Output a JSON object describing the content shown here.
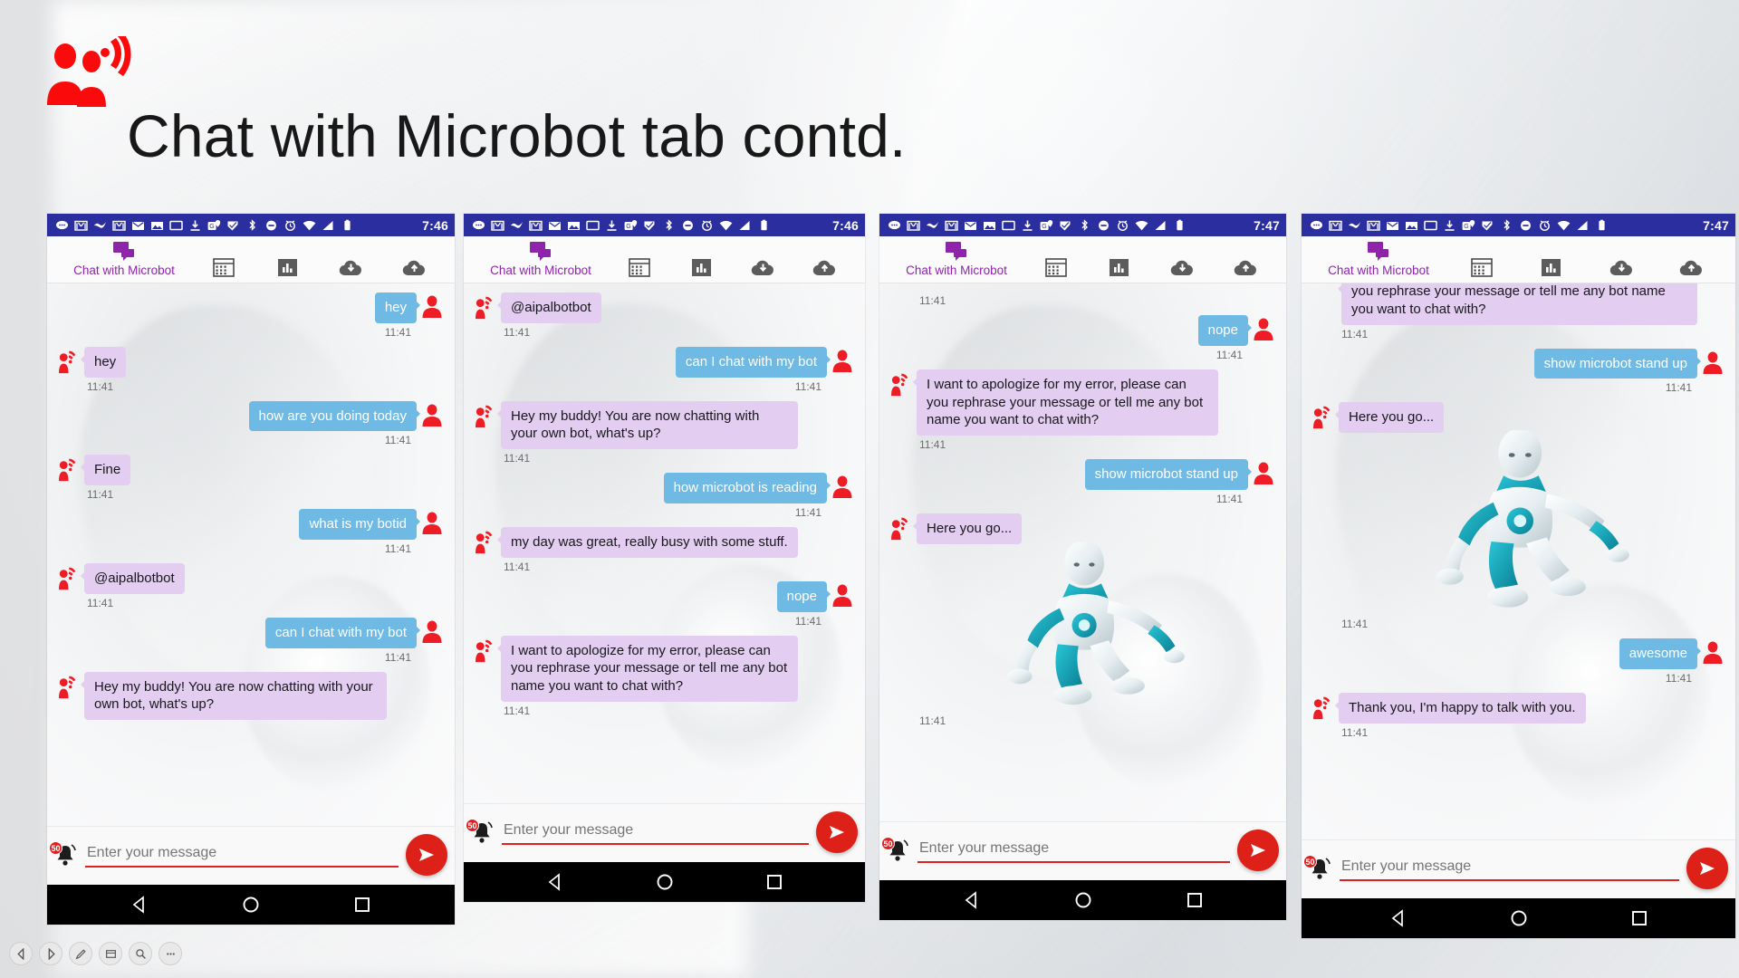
{
  "slide": {
    "title": "Chat with Microbot tab contd.",
    "logo_icon": "people-broadcast-icon"
  },
  "tabbar": {
    "chat_tab_label": "Chat with Microbot",
    "chat_tab_icon": "chat-bubbles-icon",
    "grid_tab_icon": "table-grid-icon",
    "chart_tab_icon": "bar-chart-icon",
    "download_tab_icon": "cloud-download-icon",
    "upload_tab_icon": "cloud-upload-icon",
    "accent_color": "#8e24aa"
  },
  "statusbar": {
    "icons": [
      "sms-icon",
      "gmail-icon",
      "check-icon",
      "gmail-icon",
      "mail-icon",
      "photo-icon",
      "cast-icon",
      "download-icon",
      "maps-icon",
      "tick-icon",
      "bluetooth-icon",
      "dnd-icon",
      "alarm-icon",
      "wifi-icon",
      "signal-icon",
      "battery-icon"
    ],
    "bar_color": "#2b2e9e"
  },
  "composer": {
    "placeholder": "Enter your message",
    "value": "",
    "bell_icon": "notification-bell-icon",
    "bell_badge": "50",
    "send_icon": "send-arrow-icon",
    "send_color": "#dd2119",
    "underline_color": "#e02020"
  },
  "navbar": {
    "back_icon": "nav-back-triangle-icon",
    "home_icon": "nav-home-circle-icon",
    "recents_icon": "nav-recents-square-icon"
  },
  "bottom_toolbar": {
    "buttons": [
      {
        "icon": "prev-arrow-icon"
      },
      {
        "icon": "next-arrow-icon"
      },
      {
        "icon": "pen-icon"
      },
      {
        "icon": "slides-icon"
      },
      {
        "icon": "zoom-icon"
      },
      {
        "icon": "more-options-icon"
      }
    ]
  },
  "colors": {
    "bot_bubble": "#e3cdf0",
    "user_bubble": "#6ebae4",
    "avatar_red": "#ee1c24",
    "timestamp": "#6c6c6c"
  },
  "phones": [
    {
      "id": "phone-1",
      "time": "7:46",
      "pin_bottom": false,
      "messages": [
        {
          "from": "user",
          "text": "hey",
          "time": "11:41"
        },
        {
          "from": "bot",
          "text": "hey",
          "time": "11:41"
        },
        {
          "from": "user",
          "text": "how are you doing today",
          "time": "11:41"
        },
        {
          "from": "bot",
          "text": "Fine",
          "time": "11:41"
        },
        {
          "from": "user",
          "text": "what is my botid",
          "time": "11:41"
        },
        {
          "from": "bot",
          "text": "@aipalbotbot",
          "time": "11:41"
        },
        {
          "from": "user",
          "text": "can I chat with my bot",
          "time": "11:41"
        },
        {
          "from": "bot",
          "text": "Hey my buddy! You are now chatting with your own bot, what's up?",
          "time": ""
        }
      ]
    },
    {
      "id": "phone-2",
      "time": "7:46",
      "pin_bottom": false,
      "messages": [
        {
          "from": "bot",
          "text": "@aipalbotbot",
          "time": "11:41"
        },
        {
          "from": "user",
          "text": "can I chat with my bot",
          "time": "11:41"
        },
        {
          "from": "bot",
          "text": "Hey my buddy! You are now chatting with your own bot, what's up?",
          "time": "11:41"
        },
        {
          "from": "user",
          "text": "how microbot is reading",
          "time": "11:41"
        },
        {
          "from": "bot",
          "text": "my day was great, really busy with some stuff.",
          "time": "11:41"
        },
        {
          "from": "user",
          "text": "nope",
          "time": "11:41"
        },
        {
          "from": "bot",
          "text": "I want to apologize for my error, please can you rephrase your message or tell me any bot name you want to chat with?",
          "time": "11:41"
        }
      ]
    },
    {
      "id": "phone-3",
      "time": "7:47",
      "pin_bottom": false,
      "lead_stamp": "11:41",
      "messages": [
        {
          "from": "user",
          "text": "nope",
          "time": "11:41"
        },
        {
          "from": "bot",
          "text": "I want to apologize for my error, please can you rephrase your message or tell me any bot name you want to chat with?",
          "time": "11:41"
        },
        {
          "from": "user",
          "text": "show microbot stand up",
          "time": "11:41"
        },
        {
          "from": "bot",
          "text": "Here you go...",
          "time": "11:41",
          "attachment": "robot-standing-image"
        }
      ]
    },
    {
      "id": "phone-4",
      "time": "7:47",
      "pin_bottom": false,
      "clipped_top": "you rephrase your message or tell me any bot name you want to chat with?",
      "lead_stamp": "11:41",
      "messages": [
        {
          "from": "user",
          "text": "show microbot stand up",
          "time": "11:41"
        },
        {
          "from": "bot",
          "text": "Here you go...",
          "time": "11:41",
          "attachment": "robot-standing-image"
        },
        {
          "from": "user",
          "text": "awesome",
          "time": "11:41"
        },
        {
          "from": "bot",
          "text": "Thank you, I'm happy to talk with you.",
          "time": "11:41"
        }
      ]
    }
  ]
}
